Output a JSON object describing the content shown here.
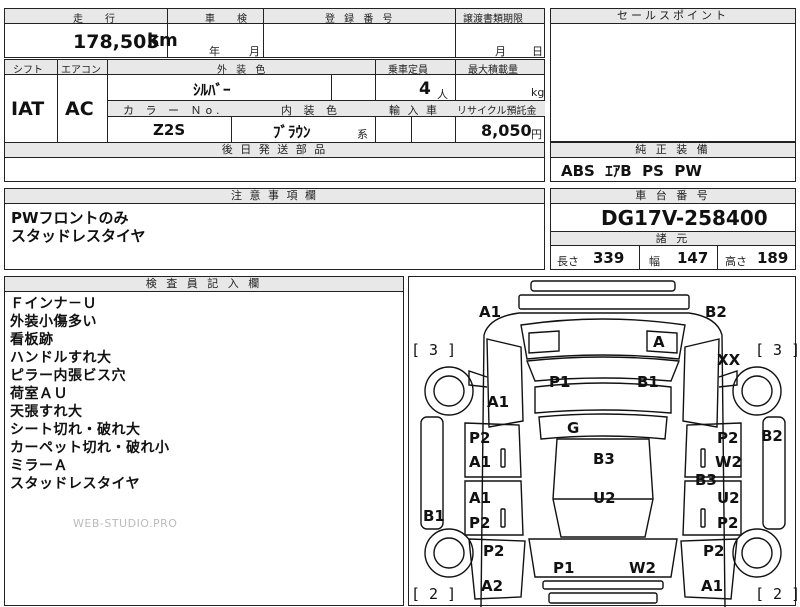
{
  "top_row": {
    "mileage_header": "走　行",
    "mileage_value": "178,505",
    "mileage_unit": "km",
    "inspection_header": "車　検",
    "inspection_year": "年",
    "inspection_month": "月",
    "registration_header": "登 録 番 号",
    "transfer_header": "譲渡書類期限",
    "transfer_month": "月",
    "transfer_day": "日"
  },
  "second_row": {
    "shift_header": "シフト",
    "aircon_header": "エアコン",
    "exterior_color_header": "外 装 色",
    "capacity_header": "乗車定員",
    "max_load_header": "最大積載量",
    "shift_value": "IAT",
    "aircon_value": "AC",
    "exterior_color_value": "ｼﾙﾊﾞｰ",
    "capacity_value": "4",
    "capacity_unit": "人",
    "max_load_unit": "kg",
    "color_no_header": "カ ラ ー Ｎo.",
    "interior_color_header": "内 装 色",
    "import_header": "輸 入 車",
    "recycle_header": "リサイクル預託金",
    "color_no_value": "Z2S",
    "interior_color_value": "ﾌﾞﾗｳﾝ",
    "interior_color_suffix": "系",
    "recycle_value": "8,050",
    "recycle_unit": "円"
  },
  "later_parts_header": "後 日 発 送 部 品",
  "notes": {
    "header": "注 意 事 項 欄",
    "lines": [
      "PWフロントのみ",
      "スタッドレスタイヤ"
    ]
  },
  "sales_points": {
    "header": "セールスポイント"
  },
  "genuine_equipment": {
    "header": "純 正 装 備",
    "value": "ABS  ｴｱB  PS  PW"
  },
  "chassis": {
    "header": "車 台 番 号",
    "value": "DG17V-258400"
  },
  "specs": {
    "header": "諸 元",
    "length_label": "長さ",
    "length_value": "339",
    "width_label": "幅",
    "width_value": "147",
    "height_label": "高さ",
    "height_value": "189"
  },
  "inspector": {
    "header": "検 査 員 記 入 欄",
    "lines": [
      "Ｆインナ－Ｕ",
      "外装小傷多い",
      "看板跡",
      "ハンドルすれ大",
      "ピラー内張ビス穴",
      "荷室ＡＵ",
      "天張すれ大",
      "シート切れ・破れ大",
      "カーペット切れ・破れ小",
      "ミラーＡ",
      "スタッドレスタイヤ"
    ]
  },
  "watermark": "WEB-STUDIO.PRO",
  "diagram": {
    "brackets": [
      "[ 3 ]",
      "[ 3 ]",
      "[ 2 ]",
      "[ 2 ]"
    ],
    "marks": [
      "A1",
      "B2",
      "A",
      "P1",
      "B1",
      "XX",
      "A1",
      "G",
      "P2",
      "A1",
      "B3",
      "P2",
      "W2",
      "B2",
      "B3",
      "A1",
      "U2",
      "U2",
      "B1",
      "P2",
      "P2",
      "P2",
      "P2",
      "P1",
      "W2",
      "A2",
      "A1"
    ]
  }
}
